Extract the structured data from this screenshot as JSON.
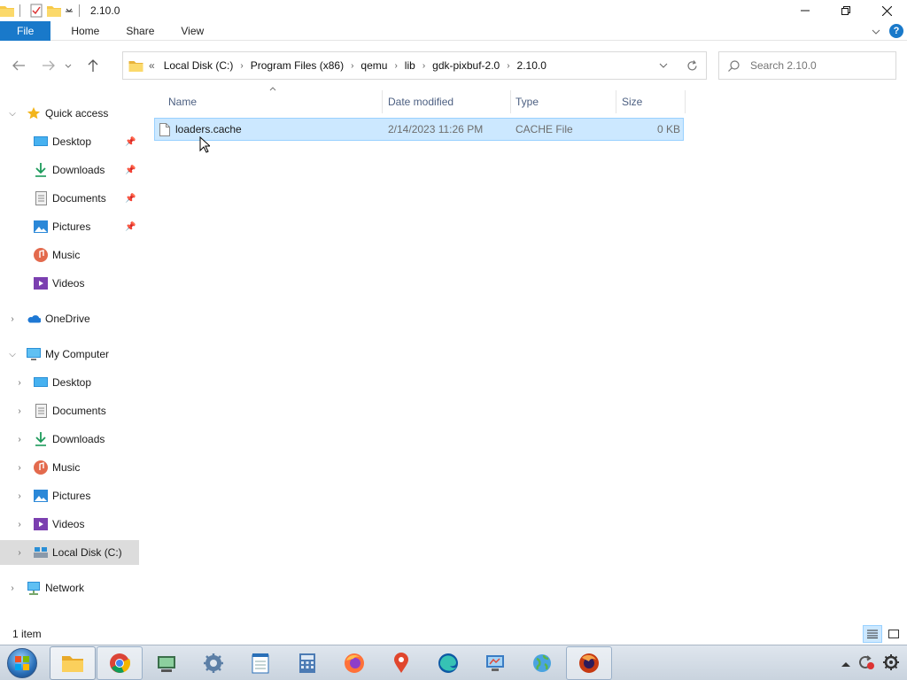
{
  "window": {
    "title": "2.10.0",
    "minimize": "—",
    "restore": "❐",
    "close": "✕"
  },
  "ribbon": {
    "tabs": [
      "File",
      "Home",
      "Share",
      "View"
    ]
  },
  "address": {
    "crumbs": [
      "Local Disk (C:)",
      "Program Files (x86)",
      "qemu",
      "lib",
      "gdk-pixbuf-2.0",
      "2.10.0"
    ],
    "overflow": "«"
  },
  "search": {
    "placeholder": "Search 2.10.0"
  },
  "sidebar": {
    "quick_access": "Quick access",
    "qa_items": [
      "Desktop",
      "Downloads",
      "Documents",
      "Pictures",
      "Music",
      "Videos"
    ],
    "onedrive": "OneDrive",
    "my_computer": "My Computer",
    "pc_items": [
      "Desktop",
      "Documents",
      "Downloads",
      "Music",
      "Pictures",
      "Videos",
      "Local Disk (C:)"
    ],
    "network": "Network"
  },
  "columns": {
    "name": "Name",
    "date": "Date modified",
    "type": "Type",
    "size": "Size"
  },
  "files": [
    {
      "name": "loaders.cache",
      "date": "2/14/2023 11:26 PM",
      "type": "CACHE File",
      "size": "0 KB"
    }
  ],
  "status": {
    "count": "1 item"
  },
  "colors": {
    "accent": "#1979ca",
    "selection": "#cce8ff",
    "selection_border": "#99d1ff"
  }
}
